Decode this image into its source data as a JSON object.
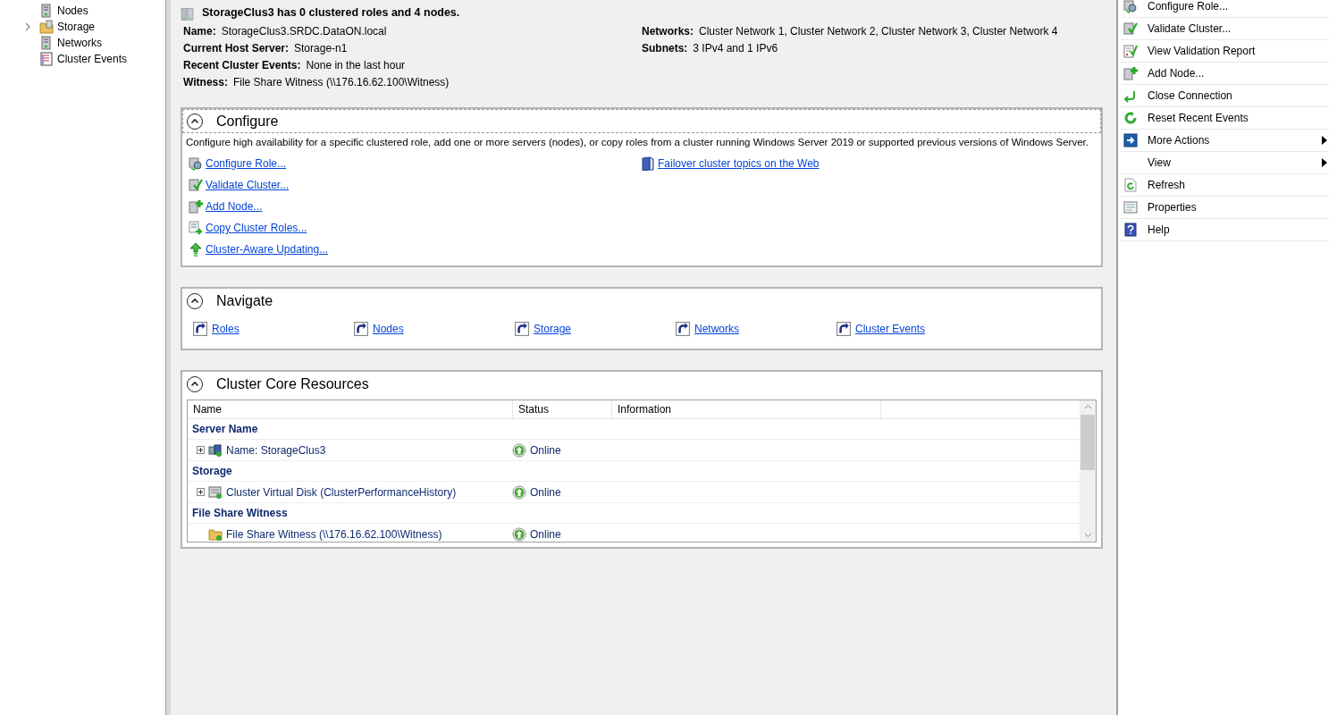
{
  "tree": {
    "items": [
      {
        "label": "Nodes",
        "expander": false
      },
      {
        "label": "Storage",
        "expander": true
      },
      {
        "label": "Networks",
        "expander": false
      },
      {
        "label": "Cluster Events",
        "expander": false
      }
    ]
  },
  "summary": {
    "headline": "StorageClus3 has 0 clustered roles and 4 nodes.",
    "fields_left": [
      {
        "label": "Name:",
        "value": "StorageClus3.SRDC.DataON.local"
      },
      {
        "label": "Current Host Server:",
        "value": "Storage-n1"
      },
      {
        "label": "Recent Cluster Events:",
        "value": "None in the last hour"
      },
      {
        "label": "Witness:",
        "value": "File Share Witness (\\\\176.16.62.100\\Witness)"
      }
    ],
    "fields_right": [
      {
        "label": "Networks:",
        "value": "Cluster Network 1, Cluster Network 2, Cluster Network 3, Cluster Network 4"
      },
      {
        "label": "Subnets:",
        "value": "3 IPv4 and 1 IPv6"
      }
    ]
  },
  "configure": {
    "title": "Configure",
    "expanded": true,
    "focused": true,
    "description": "Configure high availability for a specific clustered role, add one or more servers (nodes), or copy roles from a cluster running Windows Server 2019 or supported previous versions of Windows Server.",
    "links_left": [
      "Configure Role...",
      "Validate Cluster...",
      "Add Node...",
      "Copy Cluster Roles...",
      "Cluster-Aware Updating..."
    ],
    "links_right": [
      "Failover cluster topics on the Web"
    ]
  },
  "navigate": {
    "title": "Navigate",
    "expanded": true,
    "links": [
      "Roles",
      "Nodes",
      "Storage",
      "Networks",
      "Cluster Events"
    ]
  },
  "core_resources": {
    "title": "Cluster Core Resources",
    "expanded": true,
    "columns": [
      "Name",
      "Status",
      "Information"
    ],
    "groups": [
      {
        "title": "Server Name",
        "rows": [
          {
            "name": "Name: StorageClus3",
            "status": "Online",
            "expander": true
          }
        ]
      },
      {
        "title": "Storage",
        "rows": [
          {
            "name": "Cluster Virtual Disk (ClusterPerformanceHistory)",
            "status": "Online",
            "expander": true
          }
        ]
      },
      {
        "title": "File Share Witness",
        "rows": [
          {
            "name": "File Share Witness (\\\\176.16.62.100\\Witness)",
            "status": "Online",
            "expander": false
          }
        ]
      }
    ]
  },
  "actions": {
    "items": [
      {
        "label": "Configure Role...",
        "submenu": false
      },
      {
        "label": "Validate Cluster...",
        "submenu": false
      },
      {
        "label": "View Validation Report",
        "submenu": false
      },
      {
        "label": "Add Node...",
        "submenu": false
      },
      {
        "label": "Close Connection",
        "submenu": false
      },
      {
        "label": "Reset Recent Events",
        "submenu": false
      },
      {
        "label": "More Actions",
        "submenu": true
      },
      {
        "label": "View",
        "submenu": true
      },
      {
        "label": "Refresh",
        "submenu": false
      },
      {
        "label": "Properties",
        "submenu": false
      },
      {
        "label": "Help",
        "submenu": false
      }
    ]
  }
}
